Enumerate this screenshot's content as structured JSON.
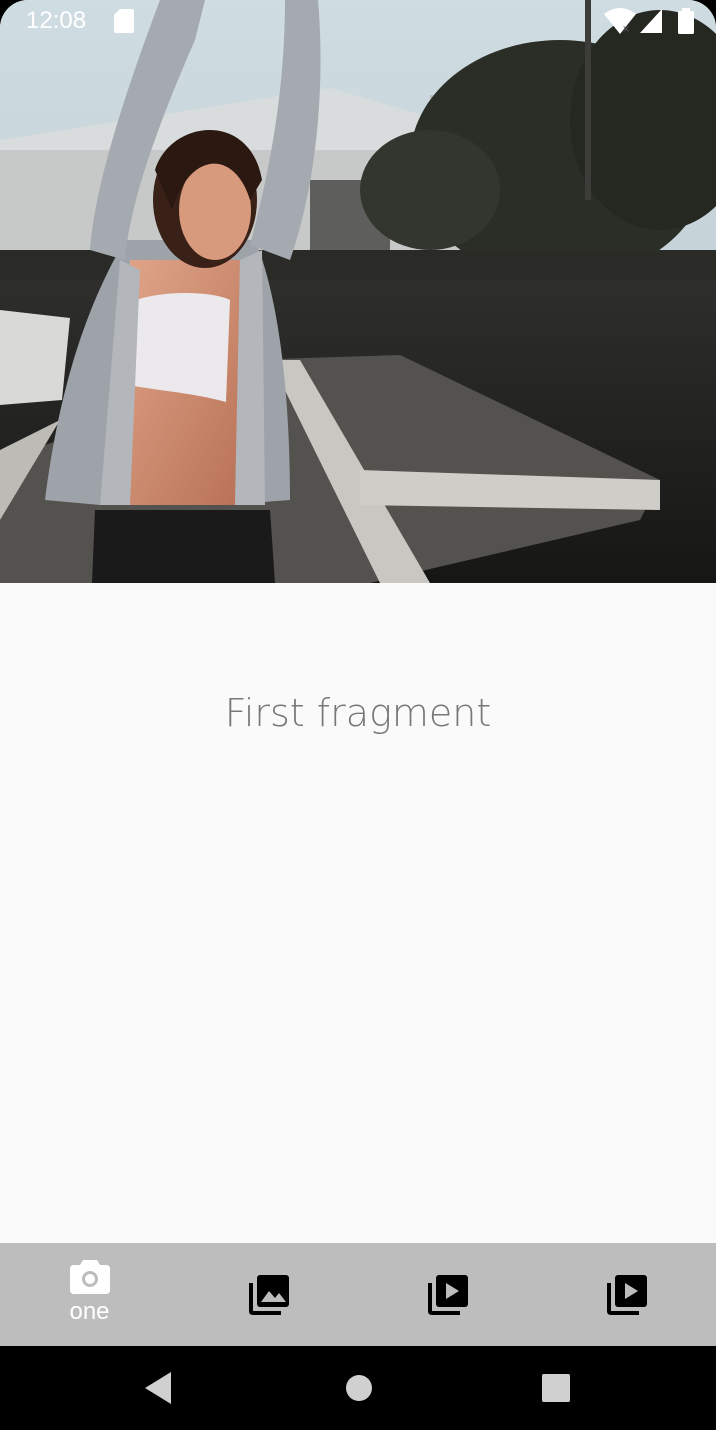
{
  "status_bar": {
    "time": "12:08",
    "icons": [
      "sd-card-icon",
      "wifi-icon",
      "cell-signal-icon",
      "battery-icon"
    ]
  },
  "hero": {
    "image": "photo-woman-stretching-on-dock"
  },
  "content": {
    "text": "First fragment"
  },
  "bottom_nav": {
    "items": [
      {
        "label": "one",
        "icon": "camera-icon",
        "selected": true
      },
      {
        "label": "",
        "icon": "photo-library-icon",
        "selected": false
      },
      {
        "label": "",
        "icon": "video-library-icon",
        "selected": false
      },
      {
        "label": "",
        "icon": "video-library-icon",
        "selected": false
      }
    ],
    "background": "#bdbdbd",
    "active_color": "#ffffff",
    "inactive_color": "#000000"
  },
  "system_nav": {
    "buttons": [
      "back-icon",
      "home-icon",
      "recents-icon"
    ]
  },
  "colors": {
    "content_bg": "#fafafa",
    "text_gray": "#777777"
  }
}
